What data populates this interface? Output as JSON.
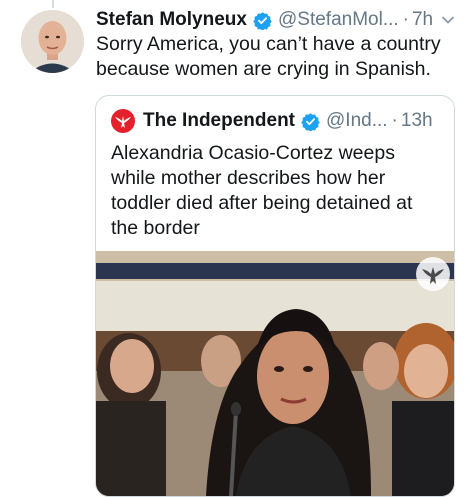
{
  "tweet": {
    "author_name": "Stefan Molyneux",
    "handle": "@StefanMol...",
    "separator": "·",
    "time": "7h",
    "text": "Sorry America, you can’t have a country because women are crying in Spanish."
  },
  "quoted_tweet": {
    "author_name": "The Independent",
    "handle": "@Ind...",
    "separator": "·",
    "time": "13h",
    "text": "Alexandria Ocasio-Cortez weeps while mother describes how her toddler died after being detained at the border"
  },
  "icons": {
    "verified": "verified-badge-icon",
    "caret": "chevron-down-icon",
    "publisher_logo": "independent-eagle-logo",
    "media_badge": "eagle-watermark-icon"
  },
  "colors": {
    "verified_blue": "#1da1f2",
    "secondary_text": "#657786",
    "border": "#cfd9de",
    "independent_red": "#e3202c"
  }
}
